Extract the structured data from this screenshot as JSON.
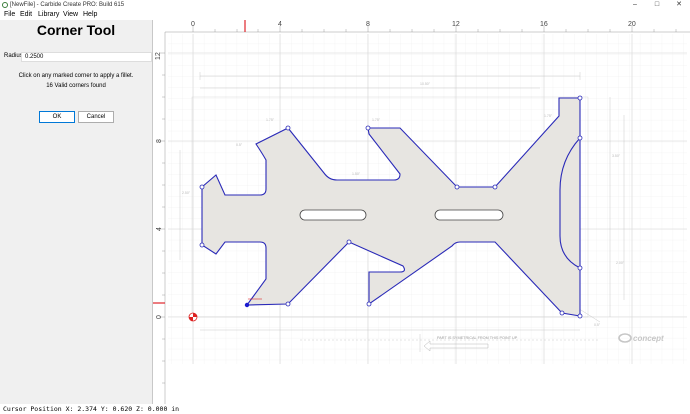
{
  "window": {
    "title": "[NewFile] - Carbide Create PRO: Build 615",
    "minimize_icon": "minimize-icon",
    "maximize_icon": "maximize-icon",
    "close_icon": "close-icon"
  },
  "menu": {
    "items": [
      {
        "label": "File"
      },
      {
        "label": "Edit"
      },
      {
        "label": "Library"
      },
      {
        "label": "View"
      },
      {
        "label": "Help"
      }
    ]
  },
  "panel": {
    "title": "Corner Tool",
    "radius_label": "Radius",
    "radius_value": "0.2500",
    "instruction": "Click on any marked corner to apply a fillet.",
    "corners_found": "16 Valid corners found",
    "ok_label": "OK",
    "cancel_label": "Cancel"
  },
  "ruler": {
    "top_labels": [
      "0",
      "4",
      "8",
      "12",
      "16",
      "20"
    ],
    "left_labels": [
      "12",
      "8",
      "4",
      "0"
    ]
  },
  "drawing": {
    "note": "PART IS SYMETRICAL FROM THIS POINT UP",
    "logo": "concept",
    "colors": {
      "shape_stroke": "#2a2ab8",
      "shape_fill": "#e7e5e1",
      "cursor_line": "#e0252b"
    }
  },
  "status": {
    "text": "Cursor Position X: 2.374 Y: 0.620 Z: 0.000 in"
  }
}
